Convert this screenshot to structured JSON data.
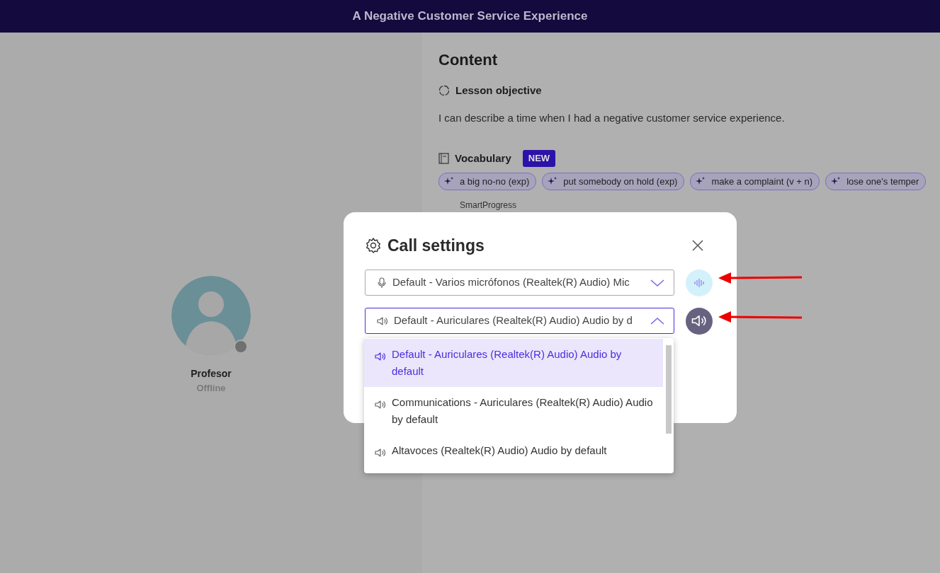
{
  "header": {
    "title": "A Negative Customer Service Experience"
  },
  "teacher": {
    "name": "Profesor",
    "status": "Offline",
    "online": false
  },
  "content": {
    "title": "Content",
    "objective_label": "Lesson objective",
    "objective": "I can describe a time when I had a negative customer service experience.",
    "vocabulary_label": "Vocabulary",
    "vocabulary_badge": "NEW",
    "vocabulary": [
      "a big no-no (exp)",
      "put somebody on hold (exp)",
      "make a complaint (v + n)",
      "lose one's temper"
    ],
    "section_label": "SmartProgress"
  },
  "dialog": {
    "title": "Call settings",
    "devices": [
      {
        "kind": "mic",
        "value": "Default - Varios micrófonos (Realtek(R) Audio) Mic",
        "open": false
      },
      {
        "kind": "speaker",
        "value": "Default - Auriculares (Realtek(R) Audio) Audio by d",
        "open": true
      }
    ],
    "options": [
      {
        "label": "Default - Auriculares (Realtek(R) Audio) Audio by default",
        "selected": true
      },
      {
        "label": "Communications - Auriculares (Realtek(R) Audio) Audio by default",
        "selected": false
      },
      {
        "label": "Altavoces (Realtek(R) Audio) Audio by default",
        "selected": false
      }
    ]
  }
}
